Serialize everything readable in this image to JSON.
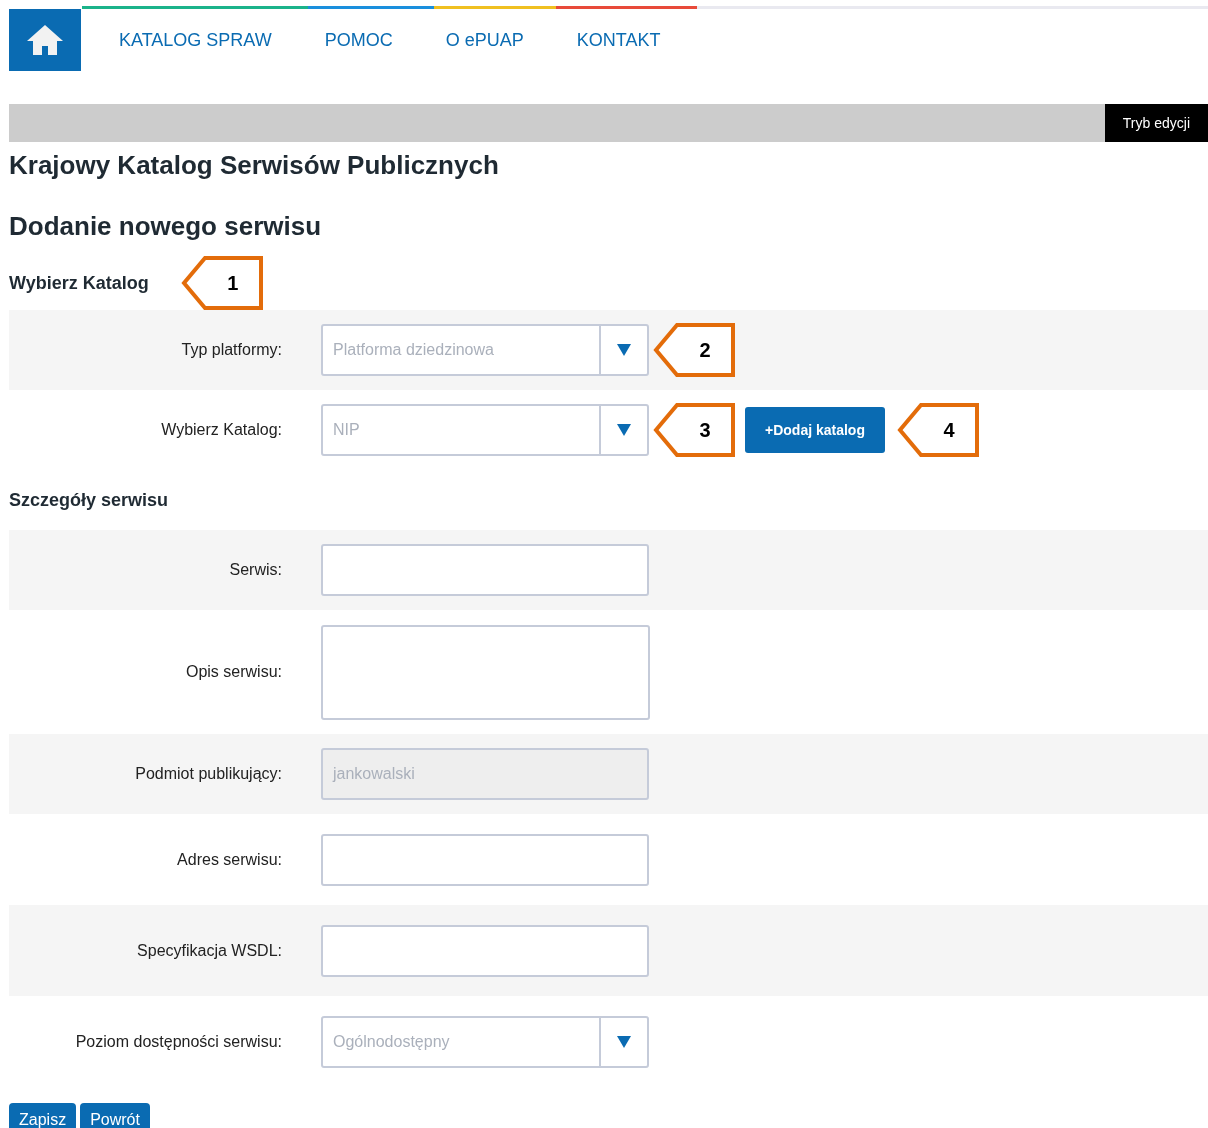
{
  "nav": {
    "items": [
      {
        "label": "KATALOG SPRAW"
      },
      {
        "label": "POMOC"
      },
      {
        "label": "O ePUAP"
      },
      {
        "label": "KONTAKT"
      }
    ]
  },
  "edit_mode_button": "Tryb edycji",
  "page_title": "Krajowy Katalog Serwisów Publicznych",
  "form_title": "Dodanie nowego serwisu",
  "sections": [
    {
      "title": "Wybierz Katalog",
      "callout": "1",
      "fields": [
        {
          "label": "Typ platformy:",
          "kind": "select",
          "value": "Platforma dziedzinowa",
          "callout": "2"
        },
        {
          "label": "Wybierz Katalog:",
          "kind": "select",
          "value": "NIP",
          "callout": "3",
          "button": "+Dodaj katalog",
          "button_callout": "4"
        }
      ]
    },
    {
      "title": "Szczegóły serwisu",
      "fields": [
        {
          "label": "Serwis:",
          "kind": "input"
        },
        {
          "label": "Opis serwisu:",
          "kind": "textarea"
        },
        {
          "label": "Podmiot publikujący:",
          "kind": "input",
          "value": "jankowalski",
          "disabled": true
        },
        {
          "label": "Adres serwisu:",
          "kind": "input"
        },
        {
          "label": "Specyfikacja WSDL:",
          "kind": "input"
        },
        {
          "label": "Poziom dostępności serwisu:",
          "kind": "select",
          "value": "Ogólnodostępny"
        }
      ]
    }
  ],
  "actions": [
    "Zapisz",
    "Powrót"
  ]
}
